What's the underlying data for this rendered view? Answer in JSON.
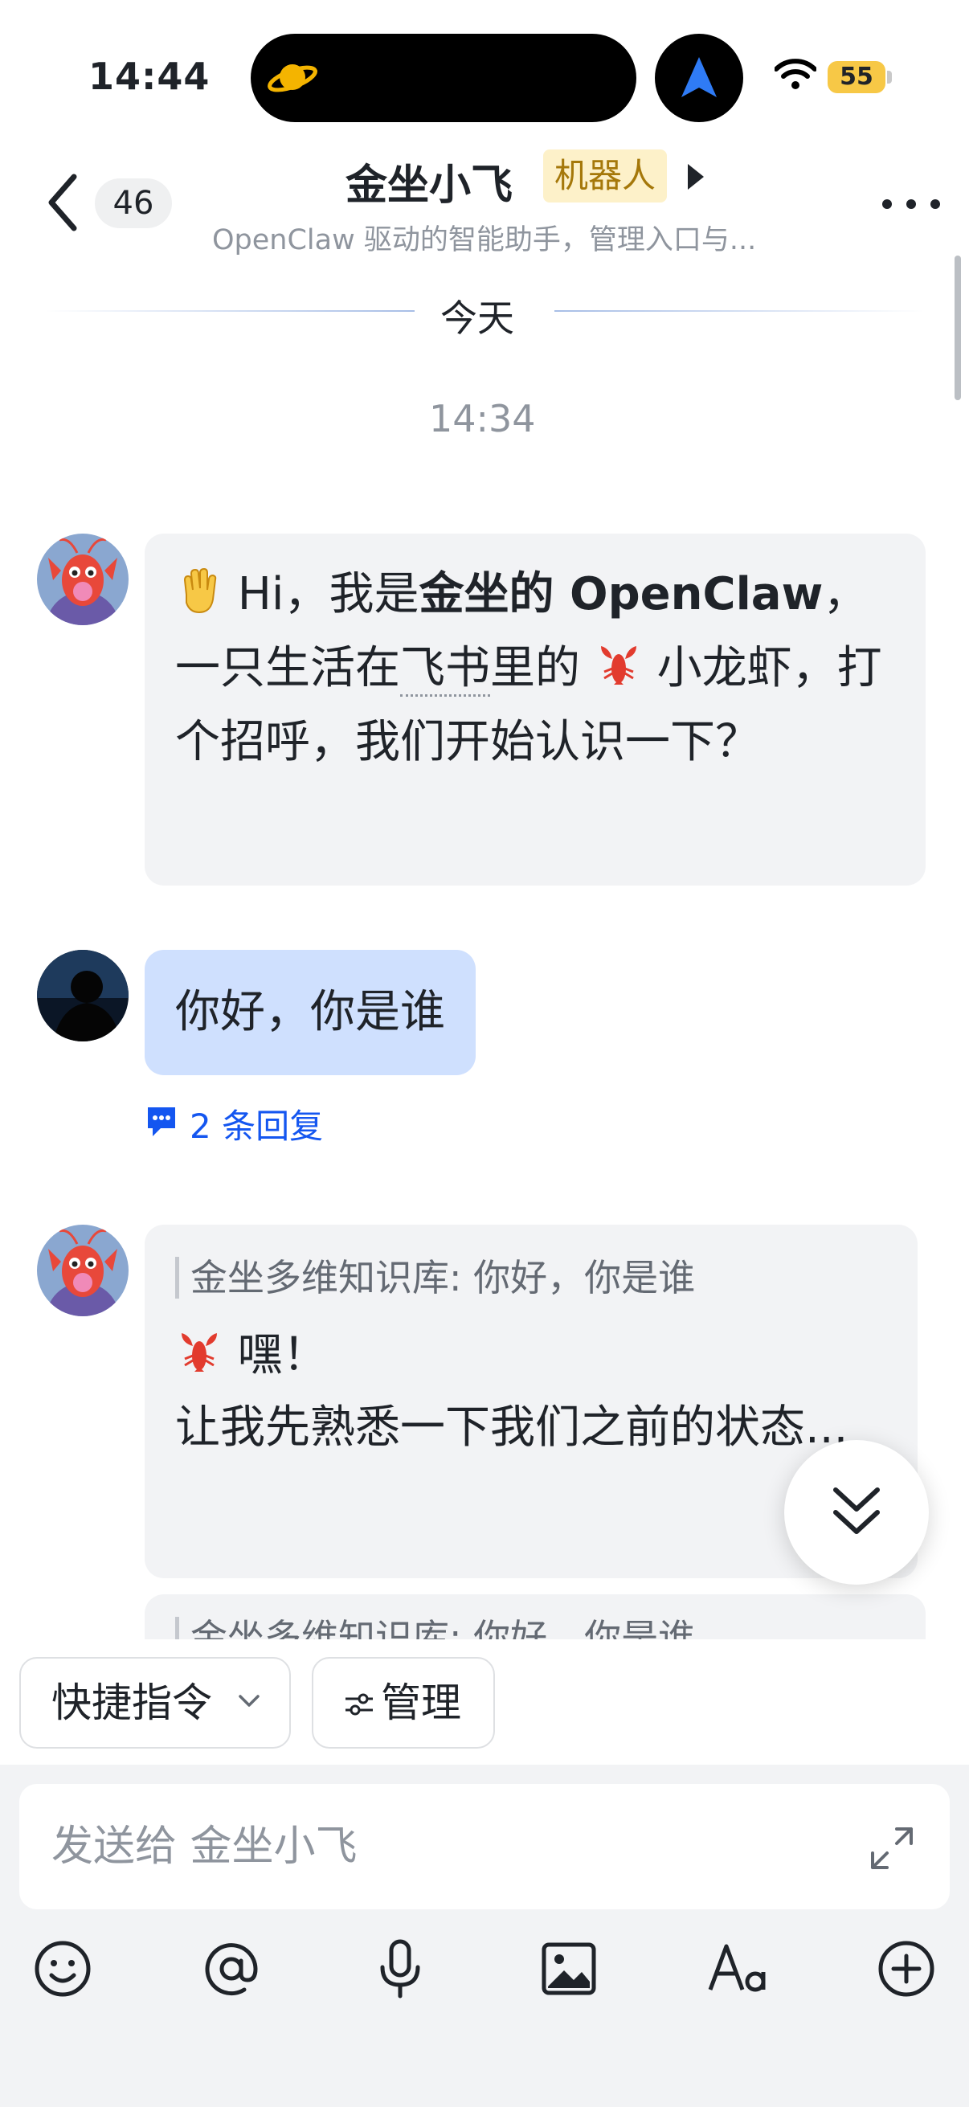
{
  "status_bar": {
    "time": "14:44",
    "battery": "55",
    "icons": [
      "planet-icon",
      "navigation-arrow-icon",
      "wifi-icon",
      "battery-icon"
    ]
  },
  "header": {
    "unread_count": "46",
    "title": "金坐小飞",
    "tag": "机器人",
    "subtitle": "OpenClaw 驱动的智能助手，管理入口与...",
    "icons": [
      "back-chevron-icon",
      "title-arrow-icon",
      "more-icon"
    ]
  },
  "timeline": {
    "date_divider": "今天",
    "timestamp": "14:34"
  },
  "messages": [
    {
      "sender": "bot",
      "parts": {
        "greeting": " Hi，我是",
        "name_bold": "金坐的 OpenClaw",
        "mid": "，一只生活在",
        "link": "飞书",
        "end1": "里的 ",
        "end2": " 小龙虾，打个招呼，我们开始认识一下？"
      },
      "emojis": [
        "waving-hand",
        "lobster"
      ]
    },
    {
      "sender": "user",
      "text": "你好，你是谁",
      "thread_reply": "2 条回复"
    },
    {
      "sender": "bot",
      "quote": "金坐多维知识库: 你好，你是谁",
      "line1": " 嘿！",
      "line2": "让我先熟悉一下我们之前的状态...",
      "emojis": [
        "lobster"
      ]
    },
    {
      "sender": "bot",
      "quote": "金坐多维知识库: 你好，你是谁"
    }
  ],
  "quick_actions": {
    "commands": "快捷指令",
    "manage": "管理"
  },
  "composer": {
    "placeholder": "发送给 金坐小飞",
    "tools": [
      "emoji-icon",
      "mention-icon",
      "microphone-icon",
      "image-icon",
      "text-format-icon",
      "plus-icon"
    ]
  },
  "colors": {
    "bot_bubble": "#f2f3f5",
    "user_bubble": "#cfe0fe",
    "link_blue": "#1456f0",
    "robot_tag_bg": "#fdf1c9",
    "robot_tag_text": "#a5780a",
    "battery": "#f7c846"
  }
}
